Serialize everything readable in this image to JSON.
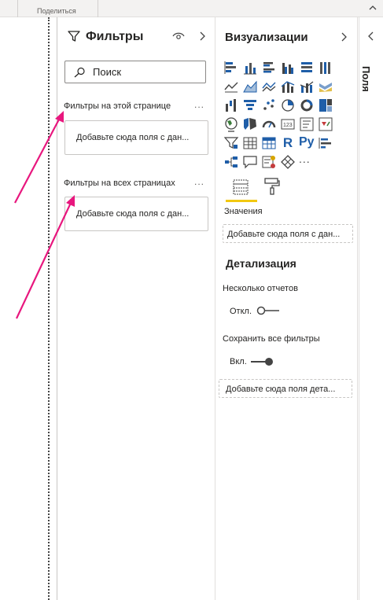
{
  "ribbon": {
    "share_label": "Поделиться"
  },
  "filters": {
    "title": "Фильтры",
    "search_placeholder": "Поиск",
    "page_section_title": "Фильтры на этой странице",
    "page_drop_text": "Добавьте сюда поля с дан...",
    "all_section_title": "Фильтры на всех страницах",
    "all_drop_text": "Добавьте сюда поля с дан...",
    "more_label": "..."
  },
  "visualizations": {
    "title": "Визуализации",
    "icons": [
      "stacked-bar-icon",
      "stacked-column-icon",
      "clustered-bar-icon",
      "clustered-column-icon",
      "100-stacked-bar-icon",
      "100-stacked-column-icon",
      "line-chart-icon",
      "area-chart-icon",
      "stacked-area-icon",
      "line-clustered-column-icon",
      "line-stacked-column-icon",
      "ribbon-chart-icon",
      "waterfall-chart-icon",
      "funnel-chart-icon",
      "scatter-chart-icon",
      "pie-chart-icon",
      "donut-chart-icon",
      "treemap-icon",
      "map-icon",
      "filled-map-icon",
      "gauge-icon",
      "card-icon",
      "multi-row-card-icon",
      "kpi-icon",
      "slicer-icon",
      "table-icon",
      "matrix-icon",
      "r-visual-icon",
      "python-visual-icon",
      "key-influencers-icon",
      "decomposition-tree-icon",
      "qa-icon",
      "smart-narrative-icon",
      "power-apps-icon",
      "more-visuals-icon"
    ],
    "r_label": "R",
    "py_label": "Py",
    "more_label": "...",
    "values_label": "Значения",
    "values_drop": "Добавьте сюда поля с дан...",
    "drill_title": "Детализация",
    "cross_report_label": "Несколько отчетов",
    "cross_report_state": "Откл.",
    "keep_filters_label": "Сохранить все фильтры",
    "keep_filters_state": "Вкл.",
    "drill_drop": "Добавьте сюда поля дета..."
  },
  "fields": {
    "title": "Поля"
  },
  "colors": {
    "accent_yellow": "#f2c811",
    "annotation_arrow": "#e8177e",
    "icon_blue": "#1f5ea8"
  }
}
